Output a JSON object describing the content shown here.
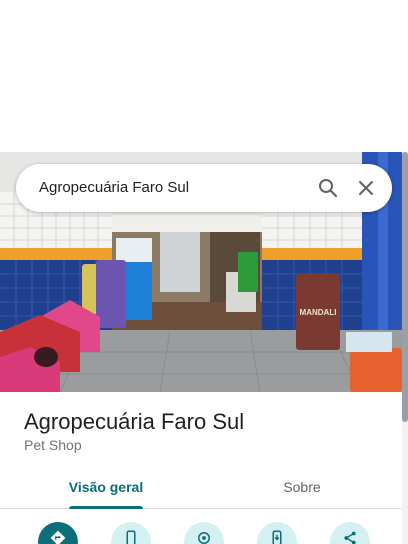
{
  "search": {
    "query": "Agropecuária Faro Sul",
    "search_icon": "search-icon",
    "close_icon": "close-icon"
  },
  "photo": {
    "description_icon": "storefront-photo",
    "product_bag_label": "MANDALI"
  },
  "place": {
    "name": "Agropecuária Faro Sul",
    "category": "Pet Shop"
  },
  "tabs": [
    {
      "label": "Visão geral",
      "selected": true
    },
    {
      "label": "Sobre",
      "selected": false
    }
  ],
  "actions": [
    {
      "icon": "directions-icon",
      "selected": true
    },
    {
      "icon": "phone-icon",
      "selected": false
    },
    {
      "icon": "nearby-icon",
      "selected": false
    },
    {
      "icon": "save-to-phone-icon",
      "selected": false
    },
    {
      "icon": "share-icon",
      "selected": false
    }
  ],
  "colors": {
    "accent": "#0b6e78",
    "secondary_button": "#d5f0f3",
    "text_primary": "#202124",
    "text_secondary": "#70757a"
  }
}
